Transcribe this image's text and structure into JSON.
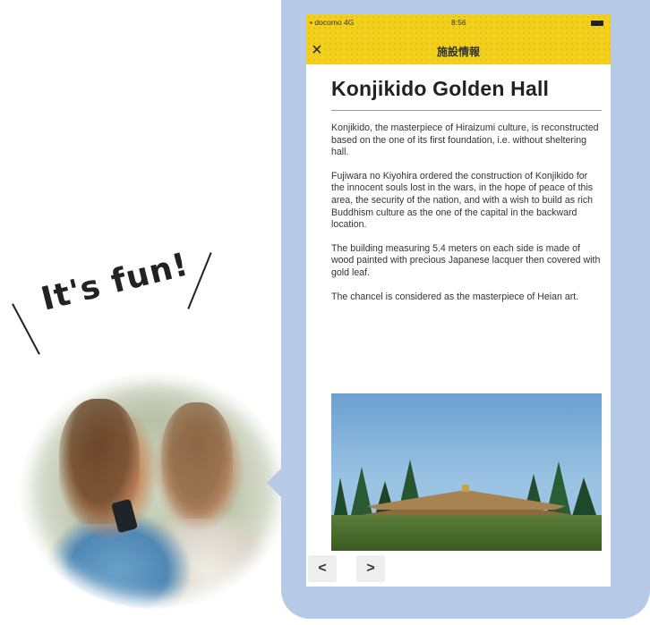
{
  "callout": {
    "text": "It's fun!"
  },
  "status_bar": {
    "carrier": "docomo 4G",
    "time": "8:56"
  },
  "nav_bar": {
    "close_glyph": "×",
    "title": "施設情報"
  },
  "article": {
    "title": "Konjikido Golden Hall",
    "paragraphs": [
      "Konjikido, the masterpiece of Hiraizumi culture, is reconstructed based on the one of its first foundation, i.e. without sheltering hall.",
      "Fujiwara no Kiyohira ordered the construction of Konjikido for the innocent souls lost in the wars, in the hope of peace of this area, the security of the nation, and with a wish to build as rich Buddhism culture as the one of the capital in the backward location.",
      "The building measuring 5.4 meters on each side is made of wood painted with precious Japanese lacquer then covered with gold leaf.",
      "The chancel is considered as the masterpiece of Heian art."
    ]
  },
  "pager": {
    "prev": "<",
    "next": ">"
  },
  "colors": {
    "frame": "#b6c9e6",
    "header": "#f3cf1e"
  },
  "icons": [
    "close-icon",
    "chevron-left-icon",
    "chevron-right-icon",
    "battery-icon",
    "signal-icon"
  ]
}
